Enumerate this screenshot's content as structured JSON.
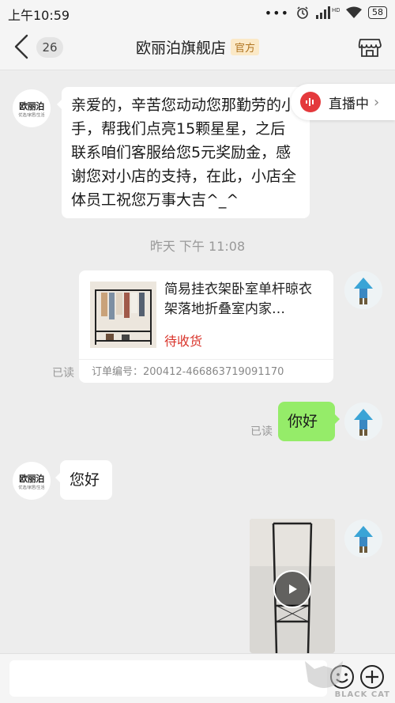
{
  "status_bar": {
    "time": "上午10:59",
    "dots": "•••",
    "hd": "HD",
    "battery": "58"
  },
  "header": {
    "unread_count": "26",
    "shop_name": "欧丽泊旗舰店",
    "official_badge": "官方"
  },
  "shop_avatar": {
    "logo": "欧丽泊",
    "sub": "优选/家居/生活"
  },
  "live_badge": {
    "label": "直播中"
  },
  "messages": {
    "welcome": "亲爱的，辛苦您动动您那勤劳的小手，帮我们点亮15颗星星，之后联系咱们客服给您5元奖励金，感谢您对小店的支持，在此，小店全体员工祝您万事大吉^_^",
    "timestamp": "昨天 下午 11:08",
    "order_card": {
      "product_title": "简易挂衣架卧室单杆晾衣架落地折叠室内家…",
      "status": "待收货",
      "order_no": "订单编号：200412-466863719091170",
      "read": "已读"
    },
    "user_hello": {
      "text": "你好",
      "read": "已读"
    },
    "shop_hello": "您好"
  },
  "watermark": {
    "text": "BLACK CAT"
  },
  "colors": {
    "bubble_green": "#95ec69",
    "status_red": "#d9342b",
    "live_red": "#e4393c"
  }
}
